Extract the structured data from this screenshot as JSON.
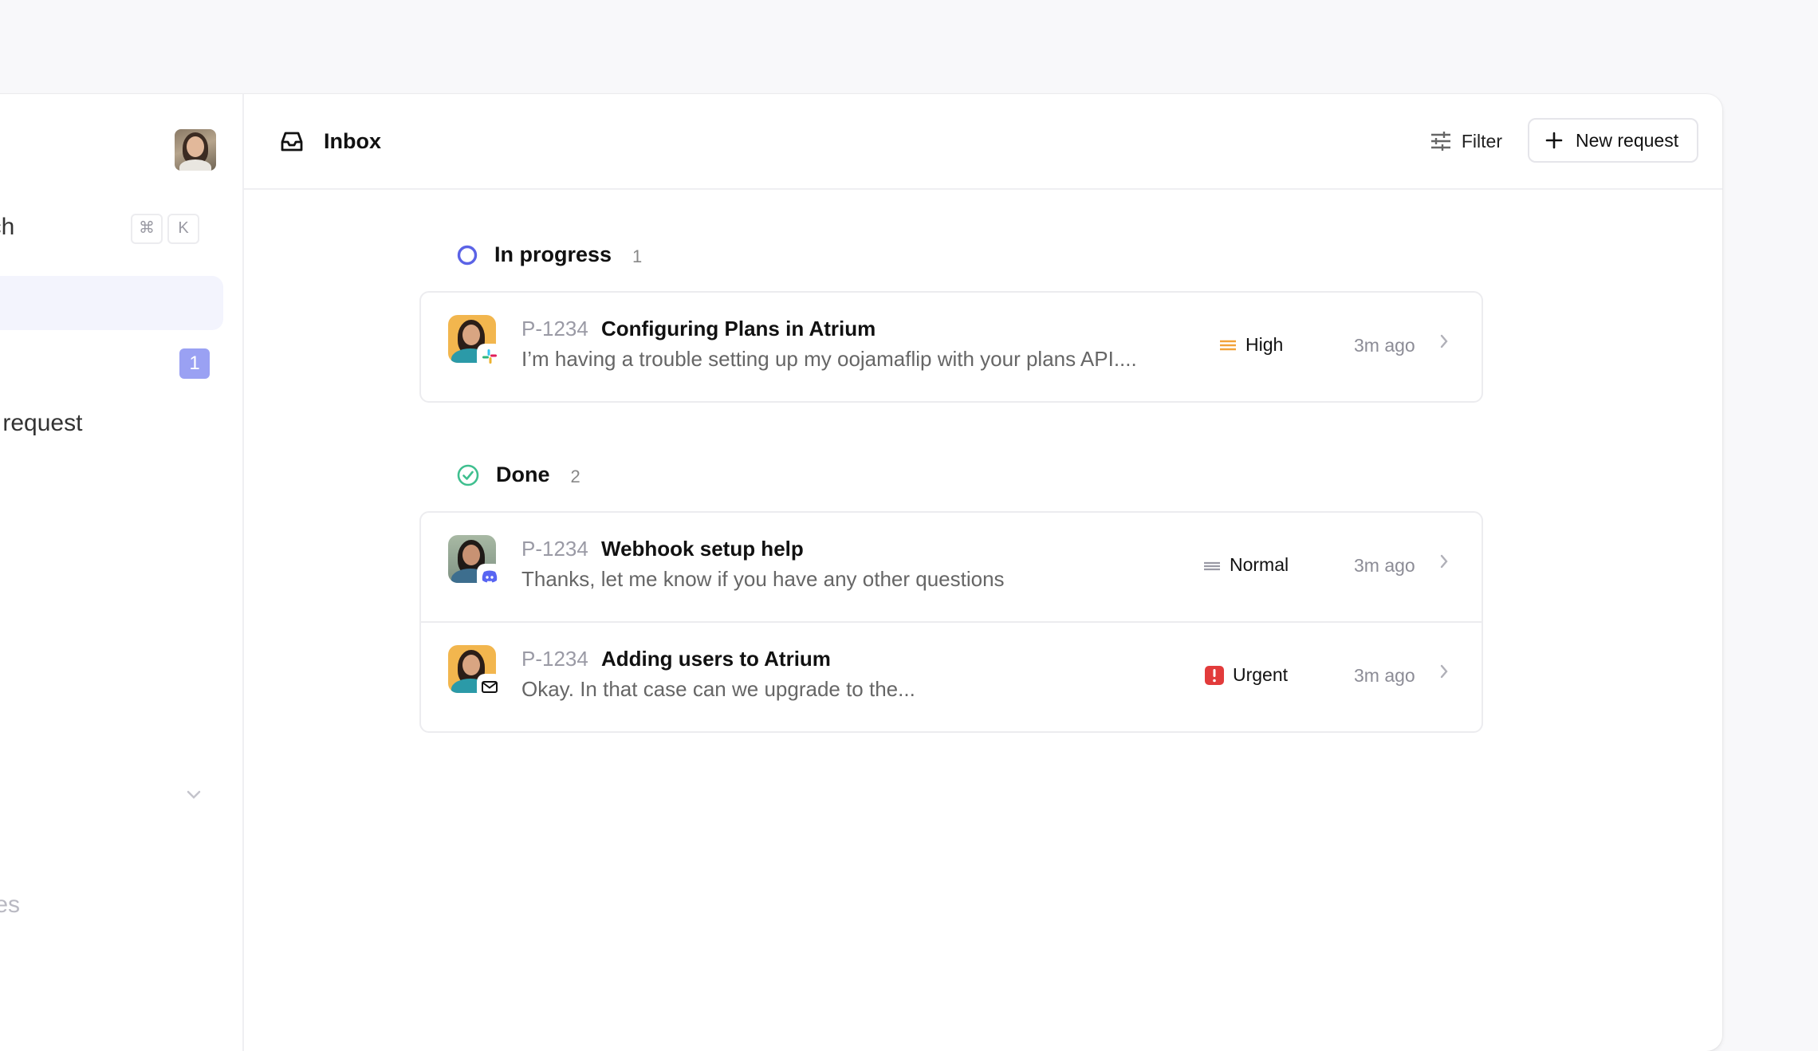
{
  "sidebar": {
    "search_label": "arch",
    "shortcut_keys": [
      "⌘",
      "K"
    ],
    "badge_count": "1",
    "support_label": "ort request",
    "codes_label": "odes"
  },
  "header": {
    "title": "Inbox",
    "filter_label": "Filter",
    "new_request_label": "New request"
  },
  "sections": [
    {
      "label": "In progress",
      "count": "1",
      "rows": [
        {
          "id": "P-1234",
          "title": "Configuring Plans in Atrium",
          "preview": "I’m having a trouble setting up my oojamaflip with your plans API....",
          "priority": "High",
          "time": "3m ago",
          "channel": "slack-icon"
        }
      ]
    },
    {
      "label": "Done",
      "count": "2",
      "rows": [
        {
          "id": "P-1234",
          "title": "Webhook setup help",
          "preview": "Thanks, let me know if you have any other questions",
          "priority": "Normal",
          "time": "3m ago",
          "channel": "discord-icon"
        },
        {
          "id": "P-1234",
          "title": "Adding users to Atrium",
          "preview": "Okay. In that case can we upgrade to the...",
          "priority": "Urgent",
          "time": "3m ago",
          "channel": "mail-icon"
        }
      ]
    }
  ],
  "colors": {
    "accent": "#5b63e6",
    "done": "#3fbf8f",
    "high": "#f2a33a",
    "urgent": "#e23b3b",
    "badge": "#9aa1f3"
  }
}
